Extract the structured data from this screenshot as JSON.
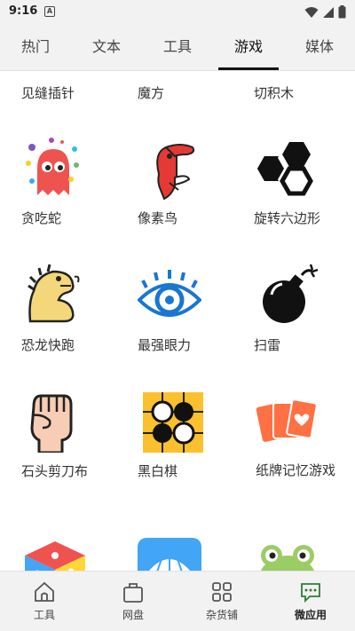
{
  "status": {
    "time": "9:16",
    "notification_letter": "A"
  },
  "tabs": [
    {
      "label": "热门"
    },
    {
      "label": "文本"
    },
    {
      "label": "工具"
    },
    {
      "label": "游戏"
    },
    {
      "label": "媒体"
    }
  ],
  "active_tab": "游戏",
  "games": [
    {
      "label": "见缝插针",
      "icon": "pin-icon"
    },
    {
      "label": "魔方",
      "icon": "cube-icon"
    },
    {
      "label": "切积木",
      "icon": "blocks-icon"
    },
    {
      "label": "贪吃蛇",
      "icon": "snake-ghost-icon"
    },
    {
      "label": "像素鸟",
      "icon": "toucan-icon"
    },
    {
      "label": "旋转六边形",
      "icon": "hexagons-icon"
    },
    {
      "label": "恐龙快跑",
      "icon": "dinosaur-icon"
    },
    {
      "label": "最强眼力",
      "icon": "eye-icon"
    },
    {
      "label": "扫雷",
      "icon": "bomb-icon"
    },
    {
      "label": "石头剪刀布",
      "icon": "fist-icon"
    },
    {
      "label": "黑白棋",
      "icon": "go-board-icon"
    },
    {
      "label": "纸牌记忆游戏",
      "icon": "cards-icon"
    },
    {
      "label": "",
      "icon": "dice-icon"
    },
    {
      "label": "",
      "icon": "umbrella-icon"
    },
    {
      "label": "",
      "icon": "frog-icon"
    }
  ],
  "bottom_nav": [
    {
      "label": "工具",
      "icon": "home-icon"
    },
    {
      "label": "网盘",
      "icon": "bag-icon"
    },
    {
      "label": "杂货铺",
      "icon": "grid-icon"
    },
    {
      "label": "微应用",
      "icon": "chat-icon"
    }
  ],
  "colors": {
    "accent": "#2e7d32",
    "bar_bg": "#f2f2f2"
  }
}
